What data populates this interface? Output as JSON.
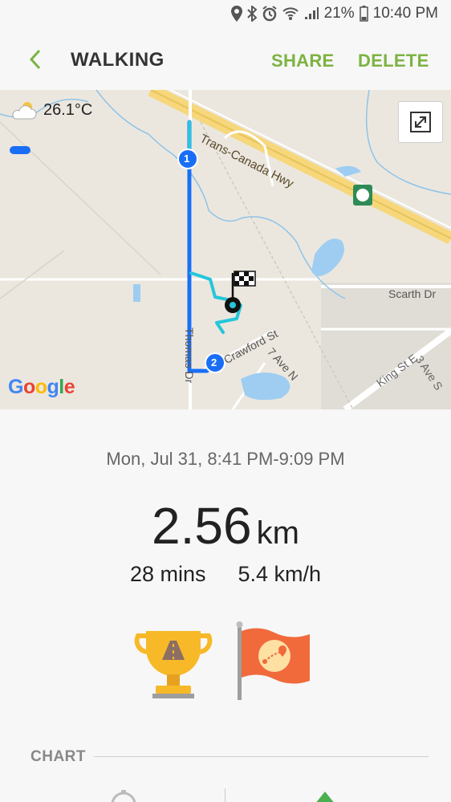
{
  "status": {
    "battery": "21%",
    "time": "10:40 PM"
  },
  "header": {
    "title": "WALKING",
    "share_label": "SHARE",
    "delete_label": "DELETE"
  },
  "map": {
    "temperature": "26.1°C",
    "google_logo": "Google",
    "labels": {
      "highway": "Trans-Canada Hwy",
      "scarth": "Scarth Dr",
      "thomas": "Thomas Dr",
      "crawford": "Crawford St",
      "seventh": "7 Ave N",
      "king": "King St E",
      "third": "3 Ave S"
    },
    "markers": [
      "1",
      "2"
    ],
    "route_colors": {
      "route1": "#1a6ef5",
      "route2": "#26c6da"
    }
  },
  "workout": {
    "datetime": "Mon, Jul 31, 8:41 PM-9:09 PM",
    "distance": "2.56",
    "distance_unit": "km",
    "duration": "28 mins",
    "speed": "5.4 km/h"
  },
  "chart": {
    "label": "CHART"
  },
  "colors": {
    "accent": "#7cb342"
  }
}
